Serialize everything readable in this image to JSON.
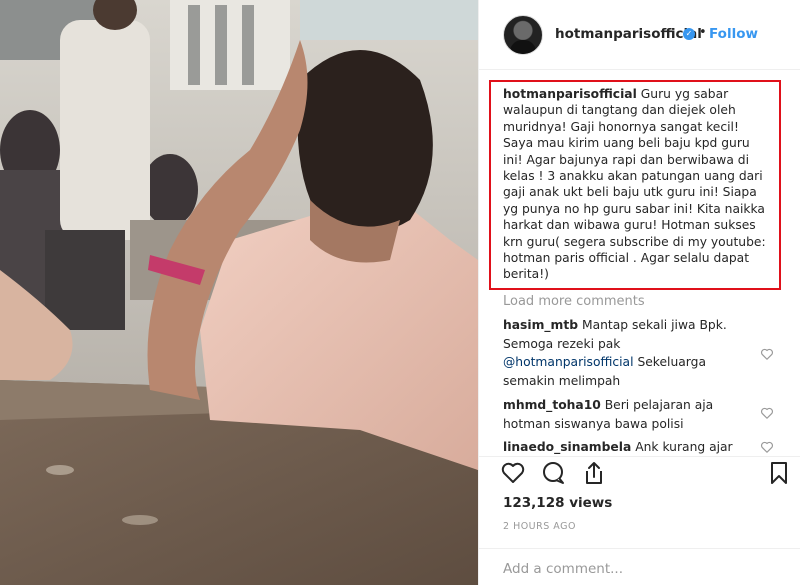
{
  "post": {
    "username": "hotmanparisofficial",
    "verified_icon": "verified-badge-icon",
    "separator": "•",
    "follow_label": "Follow"
  },
  "caption": {
    "username": "hotmanparisofficial",
    "text": "Guru yg sabar walaupun di tangtang dan diejek oleh muridnya! Gaji honornya sangat kecil! Saya mau kirim uang beli baju kpd guru ini! Agar bajunya rapi dan berwibawa di kelas ! 3 anakku akan patungan uang dari gaji anak ukt beli baju utk guru ini! Siapa yg punya no hp guru sabar ini! Kita naikka harkat dan wibawa guru! Hotman sukses krn guru( segera subscribe di my youtube: hotman paris official . Agar selalu dapat berita!)",
    "highlight_color": "#e0101a"
  },
  "load_more_label": "Load more comments",
  "comments": [
    {
      "username": "hasim_mtb",
      "text_before": "Mantap sekali jiwa Bpk. Semoga rezeki pak",
      "mention": "@hotmanparisofficial",
      "text_after": "Sekeluarga semakin melimpah"
    },
    {
      "username": "mhmd_toha10",
      "text": "Beri pelajaran aja hotman siswanya bawa polisi"
    },
    {
      "username": "linaedo_sinambela",
      "text": "Ank kurang ajar"
    }
  ],
  "actions": {
    "like_icon": "heart-icon",
    "comment_icon": "comment-icon",
    "share_icon": "share-icon",
    "save_icon": "bookmark-icon"
  },
  "views": "123,128 views",
  "timestamp": "2 HOURS AGO",
  "add_comment_placeholder": "Add a comment...",
  "colors": {
    "link": "#3897f0",
    "muted": "#999999",
    "text": "#262626",
    "border": "#efefef"
  }
}
